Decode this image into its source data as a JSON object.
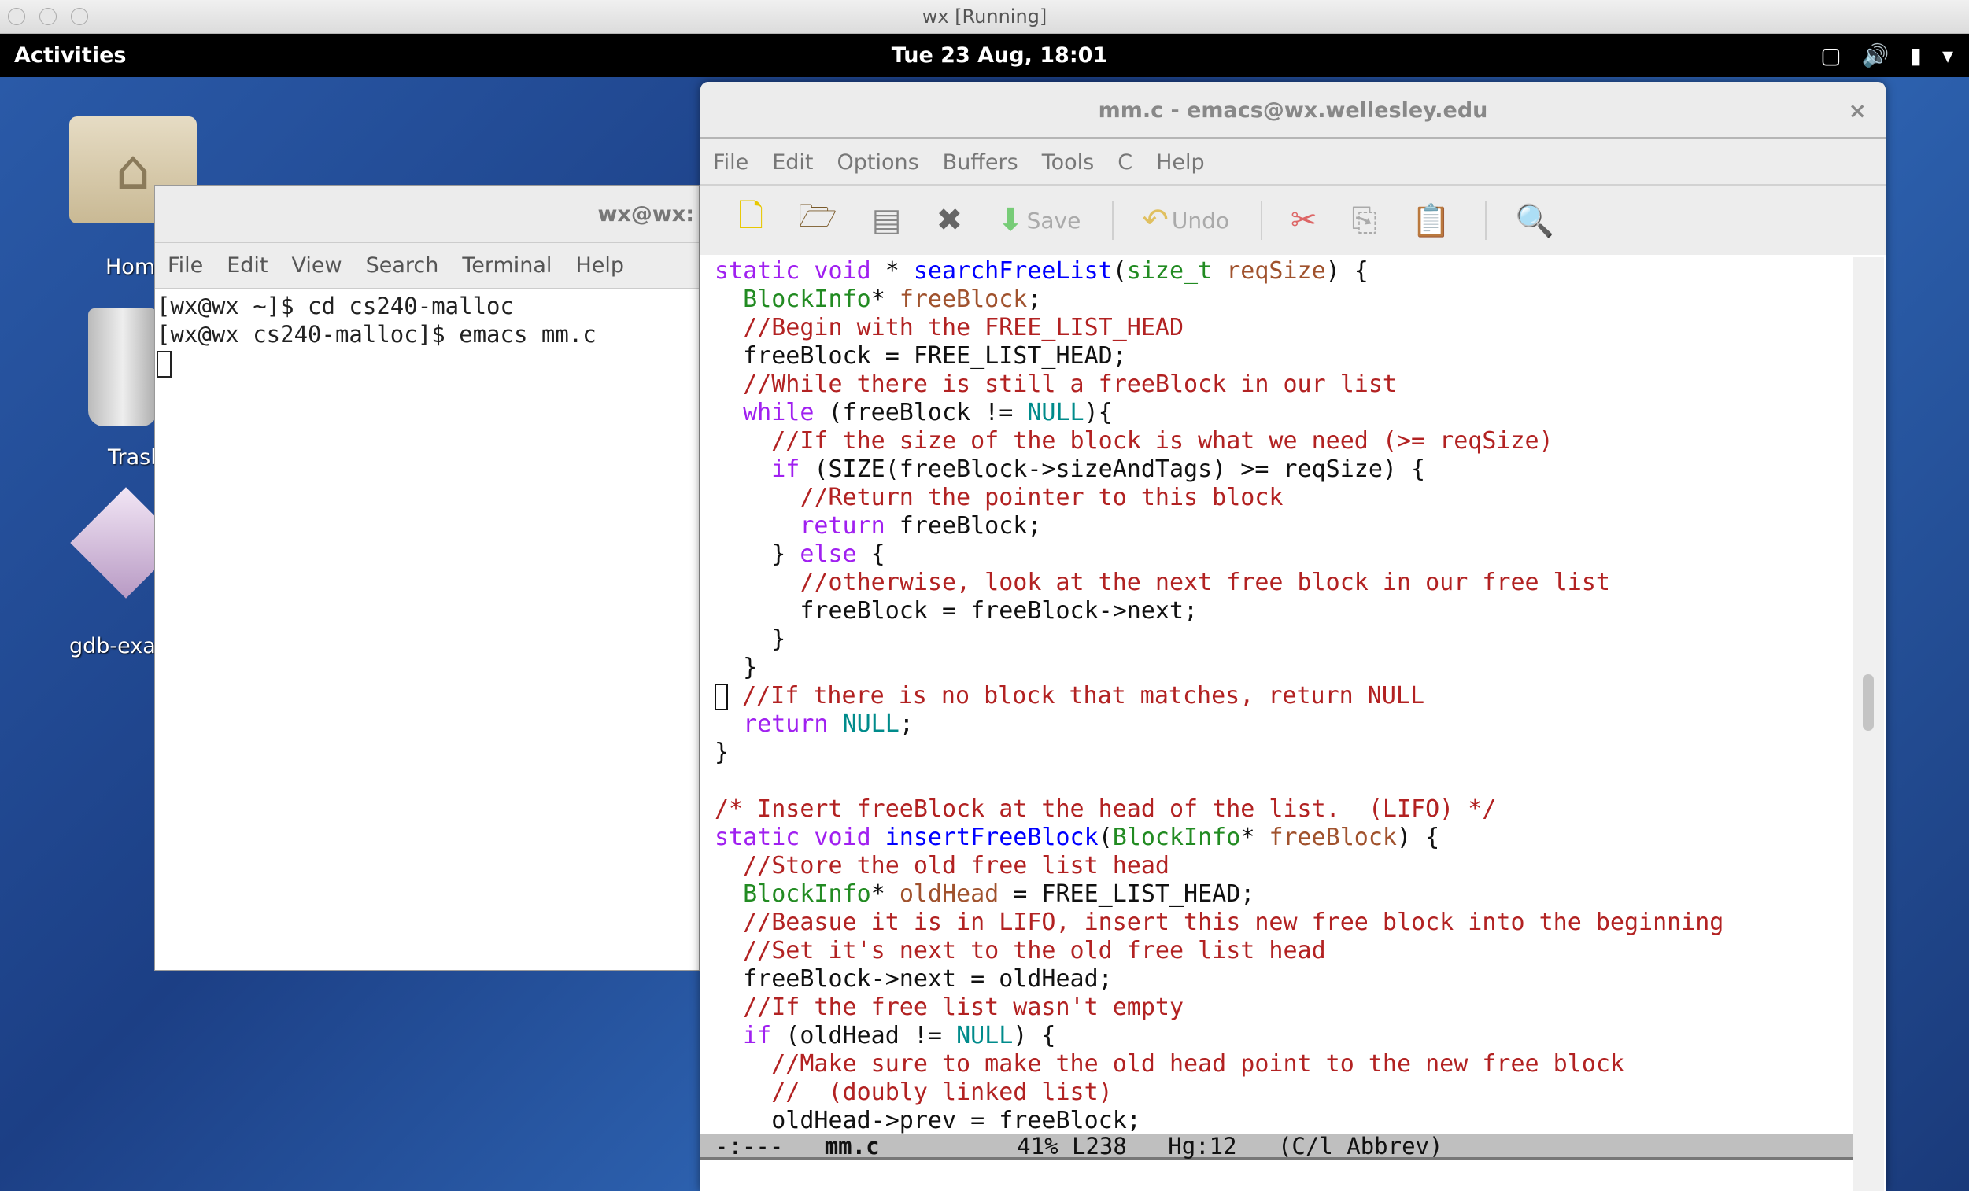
{
  "mac_window": {
    "title": "wx [Running]"
  },
  "top_bar": {
    "activities": "Activities",
    "clock": "Tue 23 Aug, 18:01",
    "tray_icons": [
      "window-icon",
      "volume-icon",
      "battery-icon",
      "chevron-down-icon"
    ]
  },
  "desktop": {
    "icons": [
      {
        "label": "Hom",
        "icon": "home-folder-icon"
      },
      {
        "label": "Trasl",
        "icon": "trash-icon"
      },
      {
        "label": "gdb-exa",
        "icon": "gdb-app-icon"
      }
    ]
  },
  "terminal": {
    "title": "wx@wx:",
    "menu": [
      "File",
      "Edit",
      "View",
      "Search",
      "Terminal",
      "Help"
    ],
    "lines": [
      "[wx@wx ~]$ cd cs240-malloc",
      "[wx@wx cs240-malloc]$ emacs mm.c"
    ]
  },
  "emacs": {
    "title": "mm.c - emacs@wx.wellesley.edu",
    "close": "×",
    "menu": [
      "File",
      "Edit",
      "Options",
      "Buffers",
      "Tools",
      "C",
      "Help"
    ],
    "toolbar": {
      "save": "Save",
      "undo": "Undo"
    },
    "colors": {
      "type": "#228b22",
      "keyword": "#a020f0",
      "function": "#0000ff",
      "variable": "#a0522d",
      "comment": "#b22222",
      "constant": "#008b8b"
    },
    "code": [
      [
        [
          "kw",
          "static void"
        ],
        [
          "pl",
          " * "
        ],
        [
          "fn",
          "searchFreeList"
        ],
        [
          "pl",
          "("
        ],
        [
          "ty",
          "size_t"
        ],
        [
          "pl",
          " "
        ],
        [
          "va",
          "reqSize"
        ],
        [
          "pl",
          ") {"
        ]
      ],
      [
        [
          "pl",
          "  "
        ],
        [
          "ty",
          "BlockInfo"
        ],
        [
          "pl",
          "* "
        ],
        [
          "va",
          "freeBlock"
        ],
        [
          "pl",
          ";"
        ]
      ],
      [
        [
          "pl",
          "  "
        ],
        [
          "cm",
          "//Begin with the FREE_LIST_HEAD"
        ]
      ],
      [
        [
          "pl",
          "  freeBlock = FREE_LIST_HEAD;"
        ]
      ],
      [
        [
          "pl",
          "  "
        ],
        [
          "cm",
          "//While there is still a freeBlock in our list"
        ]
      ],
      [
        [
          "pl",
          "  "
        ],
        [
          "kw",
          "while"
        ],
        [
          "pl",
          " (freeBlock != "
        ],
        [
          "co",
          "NULL"
        ],
        [
          "pl",
          "){"
        ]
      ],
      [
        [
          "pl",
          "    "
        ],
        [
          "cm",
          "//If the size of the block is what we need (>= reqSize)"
        ]
      ],
      [
        [
          "pl",
          "    "
        ],
        [
          "kw",
          "if"
        ],
        [
          "pl",
          " (SIZE(freeBlock->sizeAndTags) >= reqSize) {"
        ]
      ],
      [
        [
          "pl",
          "      "
        ],
        [
          "cm",
          "//Return the pointer to this block"
        ]
      ],
      [
        [
          "pl",
          "      "
        ],
        [
          "kw",
          "return"
        ],
        [
          "pl",
          " freeBlock;"
        ]
      ],
      [
        [
          "pl",
          "    } "
        ],
        [
          "kw",
          "else"
        ],
        [
          "pl",
          " {"
        ]
      ],
      [
        [
          "pl",
          "      "
        ],
        [
          "cm",
          "//otherwise, look at the next free block in our free list"
        ]
      ],
      [
        [
          "pl",
          "      freeBlock = freeBlock->next;"
        ]
      ],
      [
        [
          "pl",
          "    }"
        ]
      ],
      [
        [
          "pl",
          "  }"
        ]
      ],
      [
        [
          "cursor",
          ""
        ],
        [
          "pl",
          " "
        ],
        [
          "cm",
          "//If there is no block that matches, return NULL"
        ]
      ],
      [
        [
          "pl",
          "  "
        ],
        [
          "kw",
          "return"
        ],
        [
          "pl",
          " "
        ],
        [
          "co",
          "NULL"
        ],
        [
          "pl",
          ";"
        ]
      ],
      [
        [
          "pl",
          "}"
        ]
      ],
      [
        [
          "pl",
          ""
        ]
      ],
      [
        [
          "cm",
          "/* Insert freeBlock at the head of the list.  (LIFO) */"
        ]
      ],
      [
        [
          "kw",
          "static void"
        ],
        [
          "pl",
          " "
        ],
        [
          "fn",
          "insertFreeBlock"
        ],
        [
          "pl",
          "("
        ],
        [
          "ty",
          "BlockInfo"
        ],
        [
          "pl",
          "* "
        ],
        [
          "va",
          "freeBlock"
        ],
        [
          "pl",
          ") {"
        ]
      ],
      [
        [
          "pl",
          "  "
        ],
        [
          "cm",
          "//Store the old free list head"
        ]
      ],
      [
        [
          "pl",
          "  "
        ],
        [
          "ty",
          "BlockInfo"
        ],
        [
          "pl",
          "* "
        ],
        [
          "va",
          "oldHead"
        ],
        [
          "pl",
          " = FREE_LIST_HEAD;"
        ]
      ],
      [
        [
          "pl",
          "  "
        ],
        [
          "cm",
          "//Beasue it is in LIFO, insert this new free block into the beginning"
        ]
      ],
      [
        [
          "pl",
          "  "
        ],
        [
          "cm",
          "//Set it's next to the old free list head"
        ]
      ],
      [
        [
          "pl",
          "  freeBlock->next = oldHead;"
        ]
      ],
      [
        [
          "pl",
          "  "
        ],
        [
          "cm",
          "//If the free list wasn't empty"
        ]
      ],
      [
        [
          "pl",
          "  "
        ],
        [
          "kw",
          "if"
        ],
        [
          "pl",
          " (oldHead != "
        ],
        [
          "co",
          "NULL"
        ],
        [
          "pl",
          ") {"
        ]
      ],
      [
        [
          "pl",
          "    "
        ],
        [
          "cm",
          "//Make sure to make the old head point to the new free block"
        ]
      ],
      [
        [
          "pl",
          "    "
        ],
        [
          "cm",
          "//  (doubly linked list)"
        ]
      ],
      [
        [
          "pl",
          "    oldHead->prev = freeBlock;"
        ]
      ]
    ],
    "modeline": {
      "status": "-:---",
      "buffer": "mm.c",
      "position": "41% L238",
      "extra": "Hg:12",
      "mode": "(C/l Abbrev)"
    },
    "scroll_percent": 41
  }
}
